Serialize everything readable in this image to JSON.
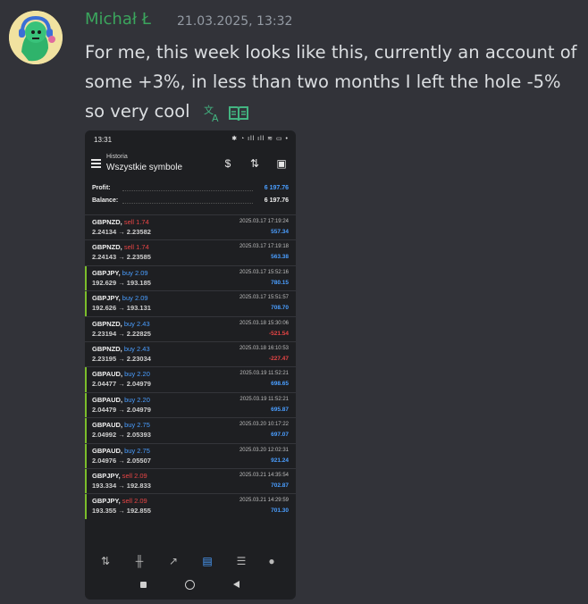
{
  "message": {
    "author": "Michał Ł",
    "timestamp": "21.03.2025, 13:32",
    "text": "For me, this week looks like this, currently an account of some +3%, in less than two months I left the hole -5% so very cool"
  },
  "colors": {
    "author": "#3ba55d",
    "buy": "#4a9eff",
    "sell": "#e84545",
    "profit_pos": "#4a9eff",
    "profit_neg": "#e84545",
    "accent_bar": "#7bbd2b"
  },
  "phone": {
    "status_time": "13:31",
    "appbar": {
      "subtitle": "Historia",
      "title": "Wszystkie symbole"
    },
    "summary": {
      "profit_label": "Profit:",
      "profit_value": "6 197.76",
      "balance_label": "Balance:",
      "balance_value": "6 197.76"
    },
    "trades": [
      {
        "symbol": "GBPNZD,",
        "side": "sell 1.74",
        "open": "2.24134",
        "close": "2.23582",
        "datetime": "2025.03.17 17:19:24",
        "profit": "557.34",
        "dir": "sell",
        "positive": true
      },
      {
        "symbol": "GBPNZD,",
        "side": "sell 1.74",
        "open": "2.24143",
        "close": "2.23585",
        "datetime": "2025.03.17 17:19:18",
        "profit": "563.38",
        "dir": "sell",
        "positive": true
      },
      {
        "symbol": "GBPJPY,",
        "side": "buy 2.09",
        "open": "192.629",
        "close": "193.185",
        "datetime": "2025.03.17 15:52:16",
        "profit": "780.15",
        "dir": "buy",
        "positive": true
      },
      {
        "symbol": "GBPJPY,",
        "side": "buy 2.09",
        "open": "192.626",
        "close": "193.131",
        "datetime": "2025.03.17 15:51:57",
        "profit": "708.70",
        "dir": "buy",
        "positive": true
      },
      {
        "symbol": "GBPNZD,",
        "side": "buy 2.43",
        "open": "2.23194",
        "close": "2.22825",
        "datetime": "2025.03.18 15:30:06",
        "profit": "-521.54",
        "dir": "buy",
        "positive": false
      },
      {
        "symbol": "GBPNZD,",
        "side": "buy 2.43",
        "open": "2.23195",
        "close": "2.23034",
        "datetime": "2025.03.18 16:10:53",
        "profit": "-227.47",
        "dir": "buy",
        "positive": false
      },
      {
        "symbol": "GBPAUD,",
        "side": "buy 2.20",
        "open": "2.04477",
        "close": "2.04979",
        "datetime": "2025.03.19 11:52:21",
        "profit": "698.65",
        "dir": "buy",
        "positive": true
      },
      {
        "symbol": "GBPAUD,",
        "side": "buy 2.20",
        "open": "2.04479",
        "close": "2.04979",
        "datetime": "2025.03.19 11:52:21",
        "profit": "695.87",
        "dir": "buy",
        "positive": true
      },
      {
        "symbol": "GBPAUD,",
        "side": "buy 2.75",
        "open": "2.04992",
        "close": "2.05393",
        "datetime": "2025.03.20 10:17:22",
        "profit": "697.07",
        "dir": "buy",
        "positive": true
      },
      {
        "symbol": "GBPAUD,",
        "side": "buy 2.75",
        "open": "2.04976",
        "close": "2.05507",
        "datetime": "2025.03.20 12:02:31",
        "profit": "921.24",
        "dir": "buy",
        "positive": true
      },
      {
        "symbol": "GBPJPY,",
        "side": "sell 2.09",
        "open": "193.334",
        "close": "192.833",
        "datetime": "2025.03.21 14:35:54",
        "profit": "702.87",
        "dir": "sell",
        "positive": true
      },
      {
        "symbol": "GBPJPY,",
        "side": "sell 2.09",
        "open": "193.355",
        "close": "192.855",
        "datetime": "2025.03.21 14:29:59",
        "profit": "701.30",
        "dir": "sell",
        "positive": true
      }
    ],
    "bottom_nav": [
      "quotes-icon",
      "chart-candles-icon",
      "trade-icon",
      "history-icon",
      "news-icon",
      "messages-icon"
    ]
  }
}
